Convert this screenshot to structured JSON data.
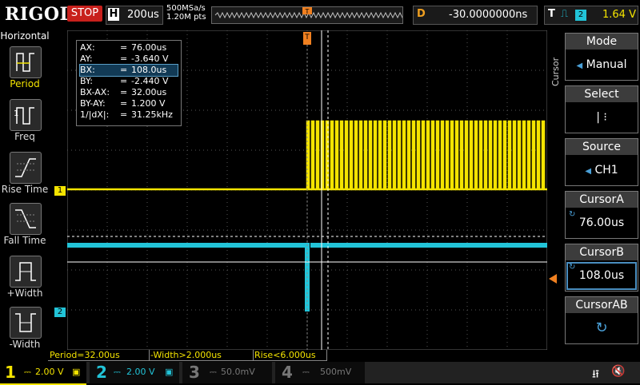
{
  "brand": "RIGOL",
  "run_status": "STOP",
  "timebase": {
    "label": "H",
    "value": "200us",
    "sample_rate": "500MSa/s",
    "points": "1.20M pts"
  },
  "delay": {
    "label": "D",
    "value": "-30.0000000ns"
  },
  "trigger": {
    "label": "T",
    "channel": "2",
    "level": "1.64 V",
    "color": "#f4e400"
  },
  "left_panel": {
    "title": "Horizontal",
    "items": [
      {
        "label": "Period",
        "icon": "period-icon",
        "color": "#f4e400"
      },
      {
        "label": "Freq",
        "icon": "freq-icon",
        "color": "#ffffff"
      },
      {
        "label": "Rise Time",
        "icon": "rise-time-icon",
        "color": "#ffffff"
      },
      {
        "label": "Fall Time",
        "icon": "fall-time-icon",
        "color": "#ffffff"
      },
      {
        "label": "+Width",
        "icon": "pos-width-icon",
        "color": "#ffffff"
      },
      {
        "label": "-Width",
        "icon": "neg-width-icon",
        "color": "#ffffff"
      }
    ]
  },
  "cursor_info": [
    {
      "key": "AX:",
      "value": "76.00us"
    },
    {
      "key": "AY:",
      "value": "-3.640 V"
    },
    {
      "key": "BX:",
      "value": "108.0us",
      "selected": true
    },
    {
      "key": "BY:",
      "value": "-2.440 V"
    },
    {
      "key": "BX-AX:",
      "value": "32.00us"
    },
    {
      "key": "BY-AY:",
      "value": "1.200 V"
    },
    {
      "key": "1/|dX|:",
      "value": "31.25kHz"
    }
  ],
  "right_panel": {
    "tab_label": "Cursor",
    "mode": {
      "label": "Mode",
      "value": "Manual"
    },
    "select": {
      "label": "Select",
      "value": "|    ⁝"
    },
    "source": {
      "label": "Source",
      "value": "CH1"
    },
    "cursor_a": {
      "label": "CursorA",
      "value": "76.00us"
    },
    "cursor_b": {
      "label": "CursorB",
      "value": "108.0us"
    },
    "cursor_ab": {
      "label": "CursorAB",
      "value": "↻"
    }
  },
  "markers": {
    "ch1": "1",
    "ch2": "2"
  },
  "measurements": [
    {
      "text": "Period=32.00us"
    },
    {
      "text": "-Width>2.000us"
    },
    {
      "text": "Rise<6.000us"
    }
  ],
  "channels": [
    {
      "num": "1",
      "scale": "2.00 V",
      "color": "#f4e400",
      "active": true
    },
    {
      "num": "2",
      "scale": "2.00 V",
      "color": "#22c4d8",
      "active": true
    },
    {
      "num": "3",
      "scale": "50.0mV",
      "color": "#777777",
      "active": false
    },
    {
      "num": "4",
      "scale": "500mV",
      "color": "#777777",
      "active": false
    }
  ],
  "colors": {
    "ch1": "#f4e400",
    "ch2": "#22c4d8",
    "trigger_marker": "#f08020",
    "accent": "#4a8ec0"
  }
}
